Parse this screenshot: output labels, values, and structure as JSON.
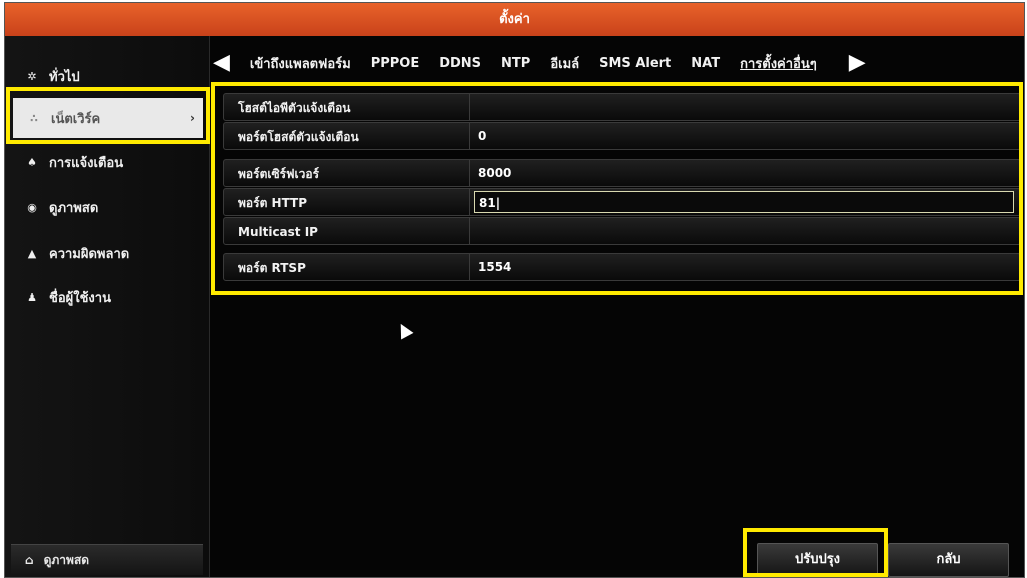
{
  "window": {
    "title": "ตั้งค่า"
  },
  "sidebar": {
    "items": [
      {
        "icon": "gear-icon",
        "glyph": "✲",
        "label": "ทั่วไป"
      },
      {
        "icon": "network-icon",
        "glyph": "∴",
        "label": "เน็ตเวิร์ค",
        "active": true,
        "arrow": "›"
      },
      {
        "icon": "alarm-icon",
        "glyph": "♠",
        "label": "การแจ้งเตือน"
      },
      {
        "icon": "eye-icon",
        "glyph": "◉",
        "label": "ดูภาพสด"
      },
      {
        "icon": "warning-icon",
        "glyph": "▲",
        "label": "ความผิดพลาด"
      },
      {
        "icon": "users-icon",
        "glyph": "♟",
        "label": "ชื่อผู้ใช้งาน"
      }
    ],
    "bottom": {
      "icon": "home-icon",
      "glyph": "⌂",
      "label": "ดูภาพสด"
    }
  },
  "tabs": {
    "left_arrow": "◀",
    "right_arrow": "▶",
    "items": [
      {
        "label": "เข้าถึงแพลตฟอร์ม"
      },
      {
        "label": "PPPOE"
      },
      {
        "label": "DDNS"
      },
      {
        "label": "NTP"
      },
      {
        "label": "อีเมล์"
      },
      {
        "label": "SMS Alert"
      },
      {
        "label": "NAT"
      },
      {
        "label": "การตั้งค่าอื่นๆ",
        "active": true
      }
    ]
  },
  "settings": {
    "rows": [
      {
        "label": "โฮสต์ไอพีตัวแจ้งเตือน",
        "value": ""
      },
      {
        "label": "พอร์ตโฮสต์ตัวแจ้งเตือน",
        "value": "0"
      },
      {
        "label": "พอร์ตเซิร์ฟเวอร์",
        "value": "8000"
      },
      {
        "label": "พอร์ต HTTP",
        "value": "81|"
      },
      {
        "label": "Multicast IP",
        "value": ""
      },
      {
        "label": "พอร์ต RTSP",
        "value": "1554"
      }
    ]
  },
  "buttons": {
    "apply": "ปรับปรุง",
    "back": "กลับ"
  },
  "colors": {
    "titlebar": "#d9521f",
    "highlight": "#ffea00"
  }
}
